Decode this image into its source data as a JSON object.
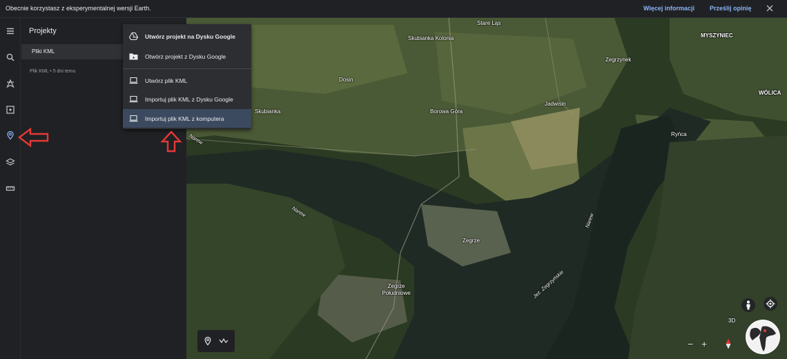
{
  "banner": {
    "text": "Obecnie korzystasz z eksperymentalnej wersji Earth.",
    "more_info": "Więcej informacji",
    "feedback": "Prześlij opinię",
    "close_icon": "close-icon"
  },
  "rail": {
    "icons": [
      "menu-icon",
      "search-icon",
      "voyager-icon",
      "feeling-lucky-icon",
      "projects-icon",
      "map-style-icon",
      "measure-icon"
    ],
    "active": "projects-icon"
  },
  "panel": {
    "title": "Projekty",
    "tab": "Pliki KML",
    "meta": "Plik KML • 5 dni temu"
  },
  "menu": {
    "items": [
      {
        "label": "Utwórz projekt na Dysku Google",
        "icon": "google-drive-icon"
      },
      {
        "label": "Otwórz projekt z Dysku Google",
        "icon": "drive-folder-icon"
      },
      {
        "label": "Utwórz plik KML",
        "icon": "laptop-icon"
      },
      {
        "label": "Importuj plik KML z Dysku Google",
        "icon": "laptop-icon"
      },
      {
        "label": "Importuj plik KML z komputera",
        "icon": "laptop-icon"
      }
    ],
    "highlighted_index": 4
  },
  "map": {
    "labels": [
      {
        "text": "Stare Ląs"
      },
      {
        "text": "Skubianka Kolonia"
      },
      {
        "text": "MYSZYNIEC"
      },
      {
        "text": "Zegrzynek"
      },
      {
        "text": "WÓLICA"
      },
      {
        "text": "Dosin"
      },
      {
        "text": "Skubianka"
      },
      {
        "text": "Borowa Góra"
      },
      {
        "text": "Jadwisin"
      },
      {
        "text": "Ryńca"
      },
      {
        "text": "Narew"
      },
      {
        "text": "Narew"
      },
      {
        "text": "Narew"
      },
      {
        "text": "Zegrze"
      },
      {
        "text": "Zegrze Południowe"
      },
      {
        "text": "Jez. Zegrzyńskie"
      }
    ]
  },
  "controls": {
    "three_d": "3D",
    "zoom_out": "−",
    "zoom_in": "+"
  },
  "colors": {
    "accent": "#8ab4f8",
    "arrow": "#e53935",
    "highlight": "#3c4a5f"
  }
}
